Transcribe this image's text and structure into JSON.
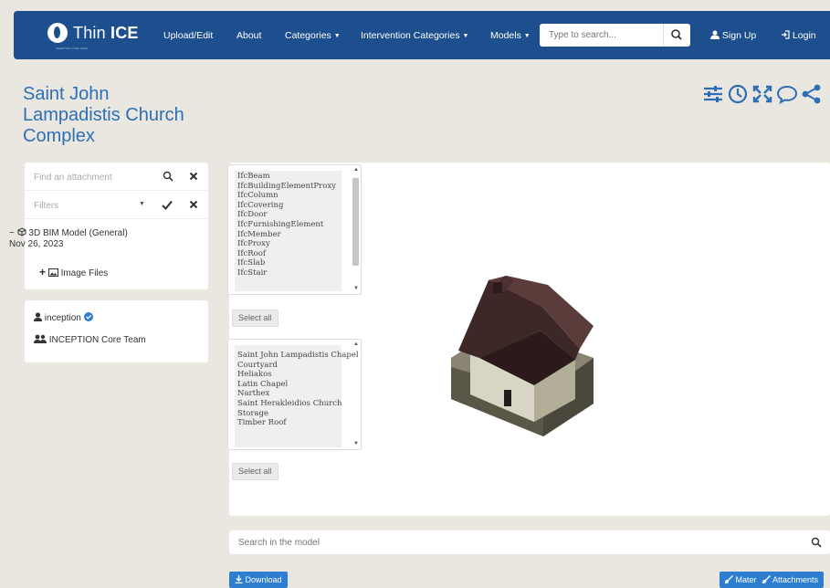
{
  "header": {
    "logo_text_light": "Thin ",
    "logo_text_bold": "ICE",
    "logo_subtext": "INCEPTION CORE TEAM",
    "nav": {
      "upload_edit": "Upload/Edit",
      "about": "About",
      "categories": "Categories",
      "intervention_categories": "Intervention Categories",
      "models": "Models"
    },
    "search_placeholder": "Type to search...",
    "sign_up": "Sign Up",
    "login": "Login"
  },
  "page_title": "Saint John Lampadistis Church Complex",
  "toolbar_icons": [
    "sliders-icon",
    "clock-icon",
    "expand-icon",
    "comment-icon",
    "share-icon"
  ],
  "sidebar": {
    "attachment_placeholder": "Find an attachment",
    "filters_placeholder": "Filters",
    "tree_root_prefix": "−",
    "tree_root_label": "3D BIM Model (General)",
    "tree_root_date": "Nov 26, 2023",
    "tree_child_prefix": "+",
    "tree_child_label": "Image Files",
    "owner_user": "inception",
    "owner_team": "INCEPTION Core Team"
  },
  "viewer": {
    "ifc_types": [
      "IfcBeam",
      "IfcBuildingElementProxy",
      "IfcColumn",
      "IfcCovering",
      "IfcDoor",
      "IfcFurnishingElement",
      "IfcMember",
      "IfcProxy",
      "IfcRoof",
      "IfcSlab",
      "IfcStair"
    ],
    "spaces": [
      "Saint John Lampadistis Chapel",
      "Courtyard",
      "Heliakos",
      "Latin Chapel",
      "Narthex",
      "Saint Herakleidios Church",
      "Storage",
      "Timber Roof"
    ],
    "select_all_1": "Select all",
    "select_all_2": "Select all",
    "model_search_placeholder": "Search in the model"
  },
  "footer": {
    "download": "Download",
    "materials": "Materials",
    "attachments": "Attachments"
  },
  "colors": {
    "navbar": "#1d4f8f",
    "accent": "#2d6fb7",
    "button": "#2d7ed0",
    "background": "#eae7e0"
  }
}
